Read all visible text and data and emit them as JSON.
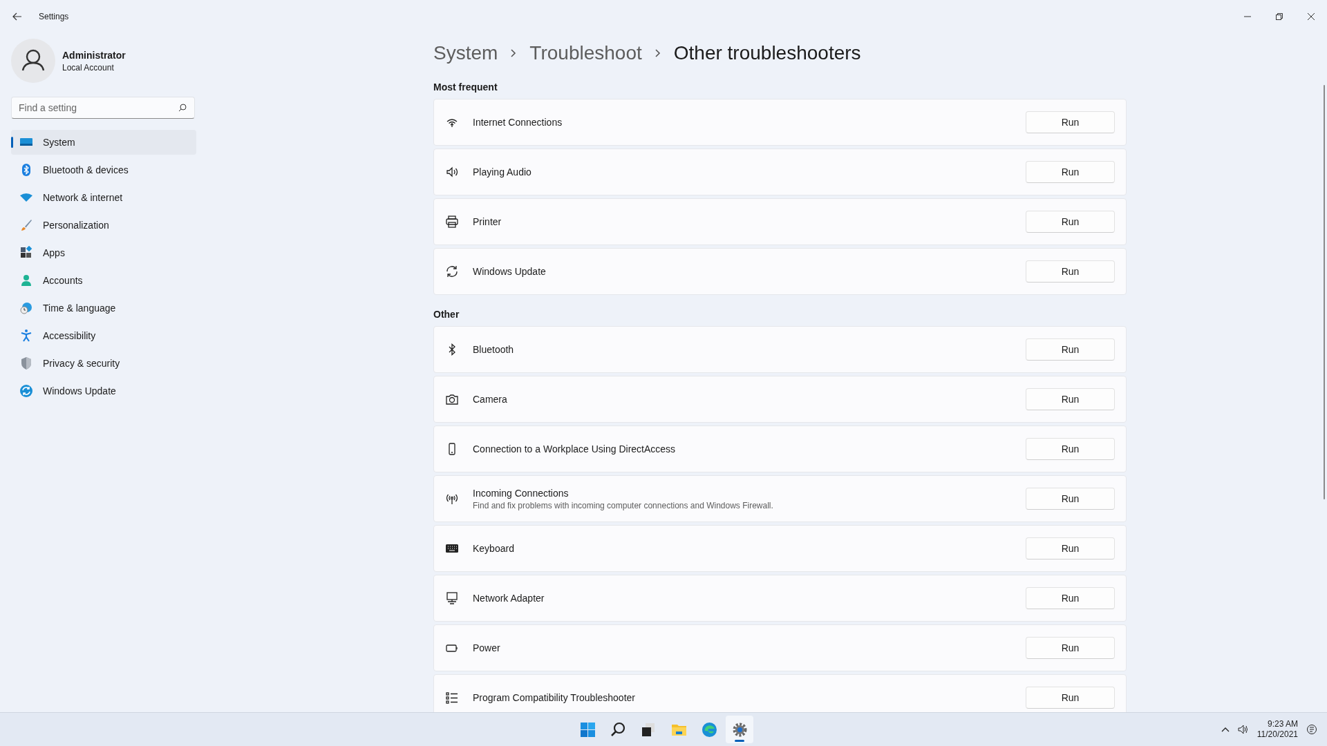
{
  "window": {
    "title": "Settings"
  },
  "account": {
    "name": "Administrator",
    "type": "Local Account"
  },
  "search": {
    "placeholder": "Find a setting"
  },
  "sidebar": {
    "items": [
      {
        "label": "System",
        "selected": true
      },
      {
        "label": "Bluetooth & devices",
        "selected": false
      },
      {
        "label": "Network & internet",
        "selected": false
      },
      {
        "label": "Personalization",
        "selected": false
      },
      {
        "label": "Apps",
        "selected": false
      },
      {
        "label": "Accounts",
        "selected": false
      },
      {
        "label": "Time & language",
        "selected": false
      },
      {
        "label": "Accessibility",
        "selected": false
      },
      {
        "label": "Privacy & security",
        "selected": false
      },
      {
        "label": "Windows Update",
        "selected": false
      }
    ]
  },
  "breadcrumb": [
    "System",
    "Troubleshoot",
    "Other troubleshooters"
  ],
  "sections": [
    {
      "title": "Most frequent",
      "items": [
        {
          "name": "Internet Connections",
          "button": "Run"
        },
        {
          "name": "Playing Audio",
          "button": "Run"
        },
        {
          "name": "Printer",
          "button": "Run"
        },
        {
          "name": "Windows Update",
          "button": "Run"
        }
      ]
    },
    {
      "title": "Other",
      "items": [
        {
          "name": "Bluetooth",
          "button": "Run"
        },
        {
          "name": "Camera",
          "button": "Run"
        },
        {
          "name": "Connection to a Workplace Using DirectAccess",
          "button": "Run"
        },
        {
          "name": "Incoming Connections",
          "description": "Find and fix problems with incoming computer connections and Windows Firewall.",
          "button": "Run"
        },
        {
          "name": "Keyboard",
          "button": "Run"
        },
        {
          "name": "Network Adapter",
          "button": "Run"
        },
        {
          "name": "Power",
          "button": "Run"
        },
        {
          "name": "Program Compatibility Troubleshooter",
          "button": "Run"
        }
      ]
    }
  ],
  "taskbar": {
    "apps": [
      {
        "selected": false
      },
      {
        "selected": false
      },
      {
        "selected": false
      },
      {
        "selected": false
      },
      {
        "selected": false
      },
      {
        "selected": true
      }
    ],
    "time": "9:23 AM",
    "date": "11/20/2021"
  }
}
